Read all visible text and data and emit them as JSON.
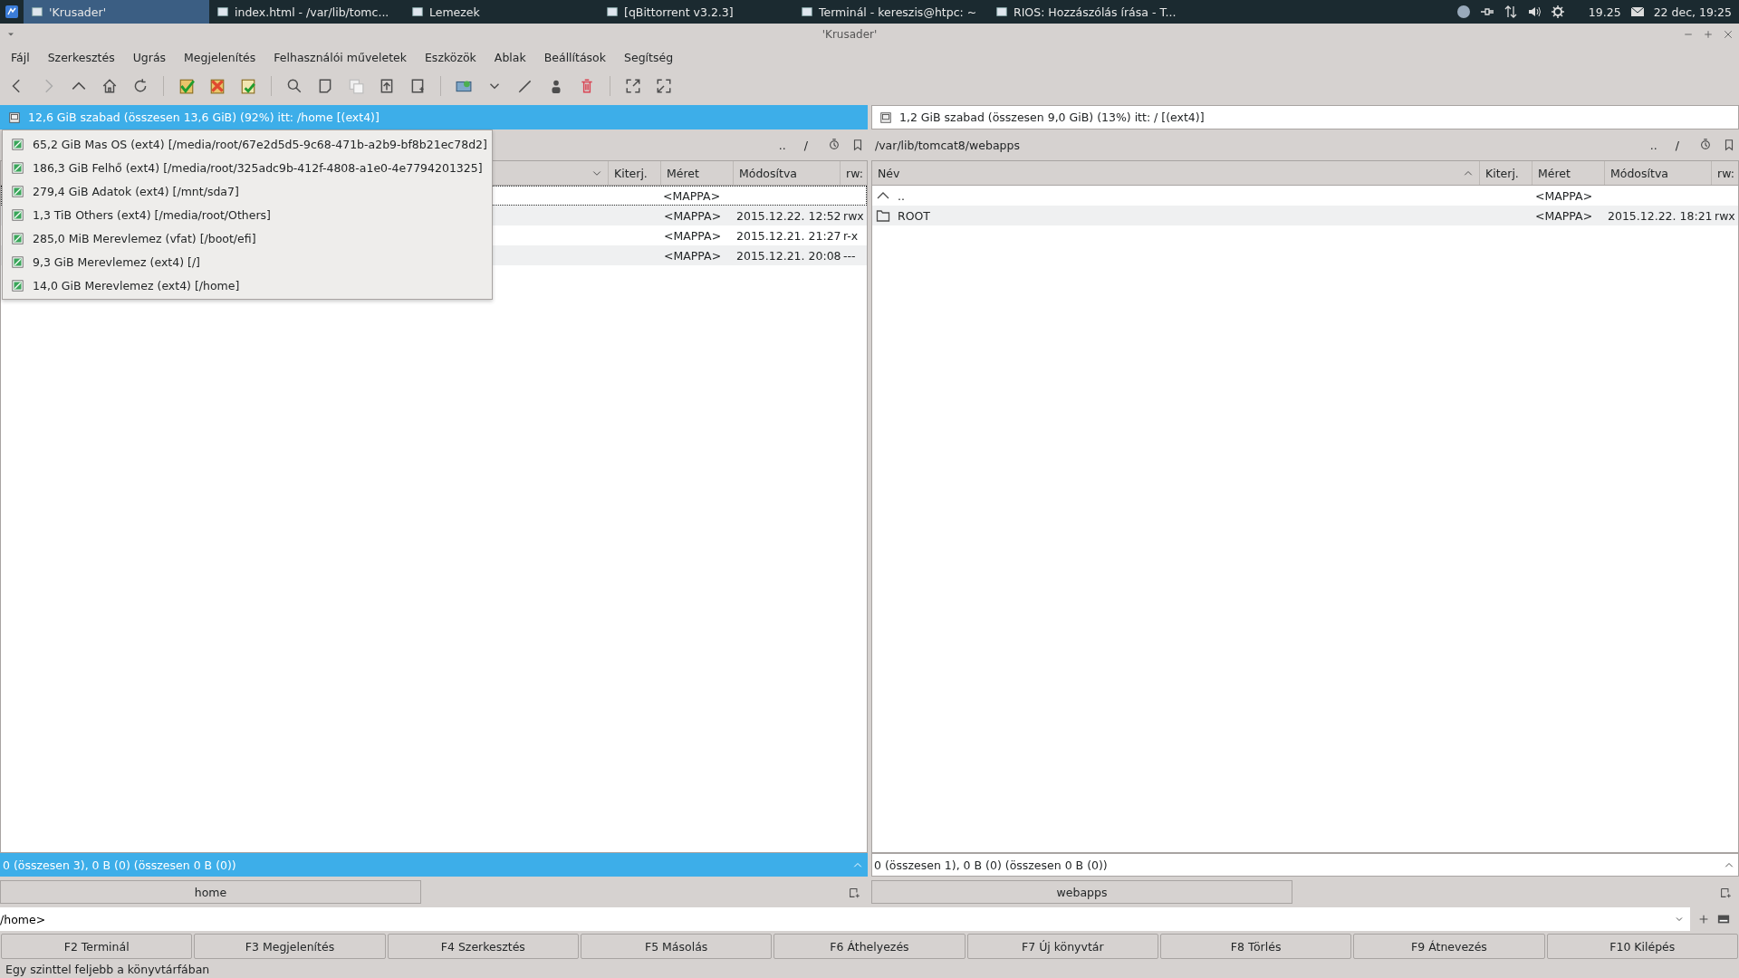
{
  "taskbar": {
    "tasks": [
      {
        "label": "'Krusader'",
        "selected": true
      },
      {
        "label": "index.html - /var/lib/tomc...",
        "selected": false
      },
      {
        "label": "Lemezek",
        "selected": false
      },
      {
        "label": "[qBittorrent v3.2.3]",
        "selected": false
      },
      {
        "label": "Terminál - kereszis@htpc: ~",
        "selected": false
      },
      {
        "label": "RIOS: Hozzászólás írása - T...",
        "selected": false
      }
    ],
    "time": "19.25",
    "date": "22 dec, 19:25"
  },
  "window": {
    "title": "'Krusader'"
  },
  "menu": [
    "Fájl",
    "Szerkesztés",
    "Ugrás",
    "Megjelenítés",
    "Felhasználói műveletek",
    "Eszközök",
    "Ablak",
    "Beállítások",
    "Segítség"
  ],
  "left_panel": {
    "active": true,
    "disk_info": "12,6 GiB szabad (összesen 13,6 GiB) (92%) itt: /home [(ext4)]",
    "disk_menu": [
      "65,2 GiB Mas OS (ext4) [/media/root/67e2d5d5-9c68-471b-a2b9-bf8b21ec78d2]",
      "186,3 GiB Felhő (ext4) [/media/root/325adc9b-412f-4808-a1e0-4e7794201325]",
      "279,4 GiB Adatok (ext4) [/mnt/sda7]",
      "1,3 TiB Others (ext4) [/media/root/Others]",
      "285,0 MiB Merevlemez (vfat) [/boot/efi]",
      "9,3 GiB Merevlemez (ext4) [/]",
      "14,0 GiB Merevlemez (ext4) [/home]"
    ],
    "path_buttons": [
      "..",
      "/"
    ],
    "name_column": {
      "sort_ascending": false
    },
    "columns": [
      "Kiterj.",
      "Méret",
      "Módosítva",
      "rw:"
    ],
    "rows": [
      {
        "focused": true,
        "size": "<MAPPA>"
      },
      {
        "focused": false,
        "size": "<MAPPA>",
        "modified": "2015.12.22. 12:52",
        "perms": "rwx"
      },
      {
        "focused": false,
        "size": "<MAPPA>",
        "modified": "2015.12.21. 21:27",
        "perms": "r-x"
      },
      {
        "focused": false,
        "size": "<MAPPA>",
        "modified": "2015.12.21. 20:08",
        "perms": "---"
      }
    ],
    "status": "0 (összesen 3), 0 B (0) (összesen 0 B (0))",
    "tab": "home"
  },
  "right_panel": {
    "active": false,
    "disk_info": "1,2 GiB szabad (összesen 9,0 GiB) (13%) itt: / [(ext4)]",
    "path": "/var/lib/tomcat8/webapps",
    "path_buttons": [
      "..",
      "/"
    ],
    "name_column": {
      "label": "Név",
      "sort_ascending": true
    },
    "columns": [
      "Kiterj.",
      "Méret",
      "Módosítva",
      "rw:"
    ],
    "rows": [
      {
        "kind": "up",
        "focused": false,
        "name": "..",
        "size": "<MAPPA>"
      },
      {
        "kind": "folder",
        "focused": false,
        "name": "ROOT",
        "size": "<MAPPA>",
        "modified": "2015.12.22. 18:21",
        "perms": "rwx"
      }
    ],
    "status": "0 (összesen 1), 0 B (0) (összesen 0 B (0))",
    "tab": "webapps"
  },
  "command_line": {
    "value": "/home>"
  },
  "function_keys": [
    "F2 Terminál",
    "F3 Megjelenítés",
    "F4 Szerkesztés",
    "F5 Másolás",
    "F6 Áthelyezés",
    "F7 Új könyvtár",
    "F8 Törlés",
    "F9 Átnevezés",
    "F10 Kilépés"
  ],
  "status_bar": "Egy szinttel feljebb a könyvtárfában"
}
